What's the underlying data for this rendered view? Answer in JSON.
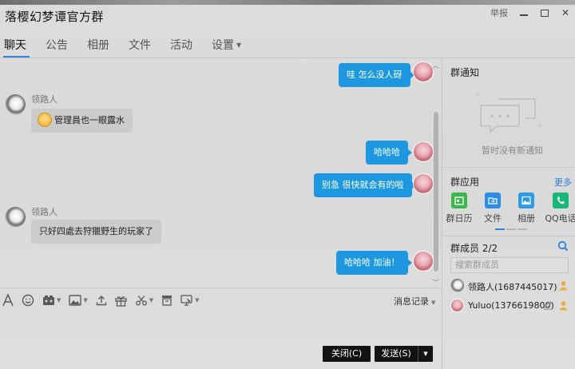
{
  "window": {
    "title": "落樱幻梦谭官方群",
    "report_label": "举报",
    "minimize_icon": "minimize-icon",
    "maximize_icon": "maximize-icon",
    "close_icon": "close-icon"
  },
  "tabs": [
    {
      "label": "聊天",
      "active": true
    },
    {
      "label": "公告"
    },
    {
      "label": "相册"
    },
    {
      "label": "文件"
    },
    {
      "label": "活动"
    },
    {
      "label": "设置",
      "has_dropdown": true
    }
  ],
  "messages": [
    {
      "side": "mine",
      "text": "哇 怎么没人砑"
    },
    {
      "side": "other",
      "nickname": "领路人",
      "text": "管理員也一眼露水",
      "emoji": "crying-face-emoji"
    },
    {
      "side": "mine",
      "text": "哈哈哈"
    },
    {
      "side": "mine",
      "text": "别急 很快就会有的啦"
    },
    {
      "side": "other",
      "nickname": "领路人",
      "text": "只好四處去狩獵野生的玩家了"
    },
    {
      "side": "mine",
      "text": "哈哈哈  加油！"
    }
  ],
  "toolbar": {
    "icons": [
      "font-icon",
      "emoji-icon",
      "gallery-icon",
      "image-icon",
      "upload-icon",
      "gift-icon",
      "scissors-icon",
      "archive-icon",
      "screen-share-icon"
    ],
    "history_label": "消息记录"
  },
  "buttons": {
    "close_label": "关闭(C)",
    "send_label": "发送(S)"
  },
  "notice": {
    "title": "群通知",
    "empty_text": "暂时没有新通知"
  },
  "apps": {
    "title": "群应用",
    "more_label": "更多",
    "items": [
      {
        "label": "群日历",
        "icon": "calendar-icon",
        "color": "#3cb64a"
      },
      {
        "label": "文件",
        "icon": "file-icon",
        "color": "#2d8ee6"
      },
      {
        "label": "相册",
        "icon": "album-icon",
        "color": "#2d9ae6"
      },
      {
        "label": "QQ电话",
        "icon": "phone-icon",
        "color": "#17b77a"
      }
    ]
  },
  "members": {
    "title": "群成员 2/2",
    "search_placeholder": "搜索群成员",
    "list": [
      {
        "name": "领路人(1687445017)",
        "badge": "owner-icon"
      },
      {
        "name": "Yuluo(1376619800)",
        "badge": "admin-icon",
        "edit_icon": "edit-icon"
      }
    ]
  },
  "colors": {
    "accent": "#2c83d8",
    "bubble_mine": "#1d98e0",
    "bubble_other": "#cbcbcb",
    "button_dark": "#131313"
  }
}
